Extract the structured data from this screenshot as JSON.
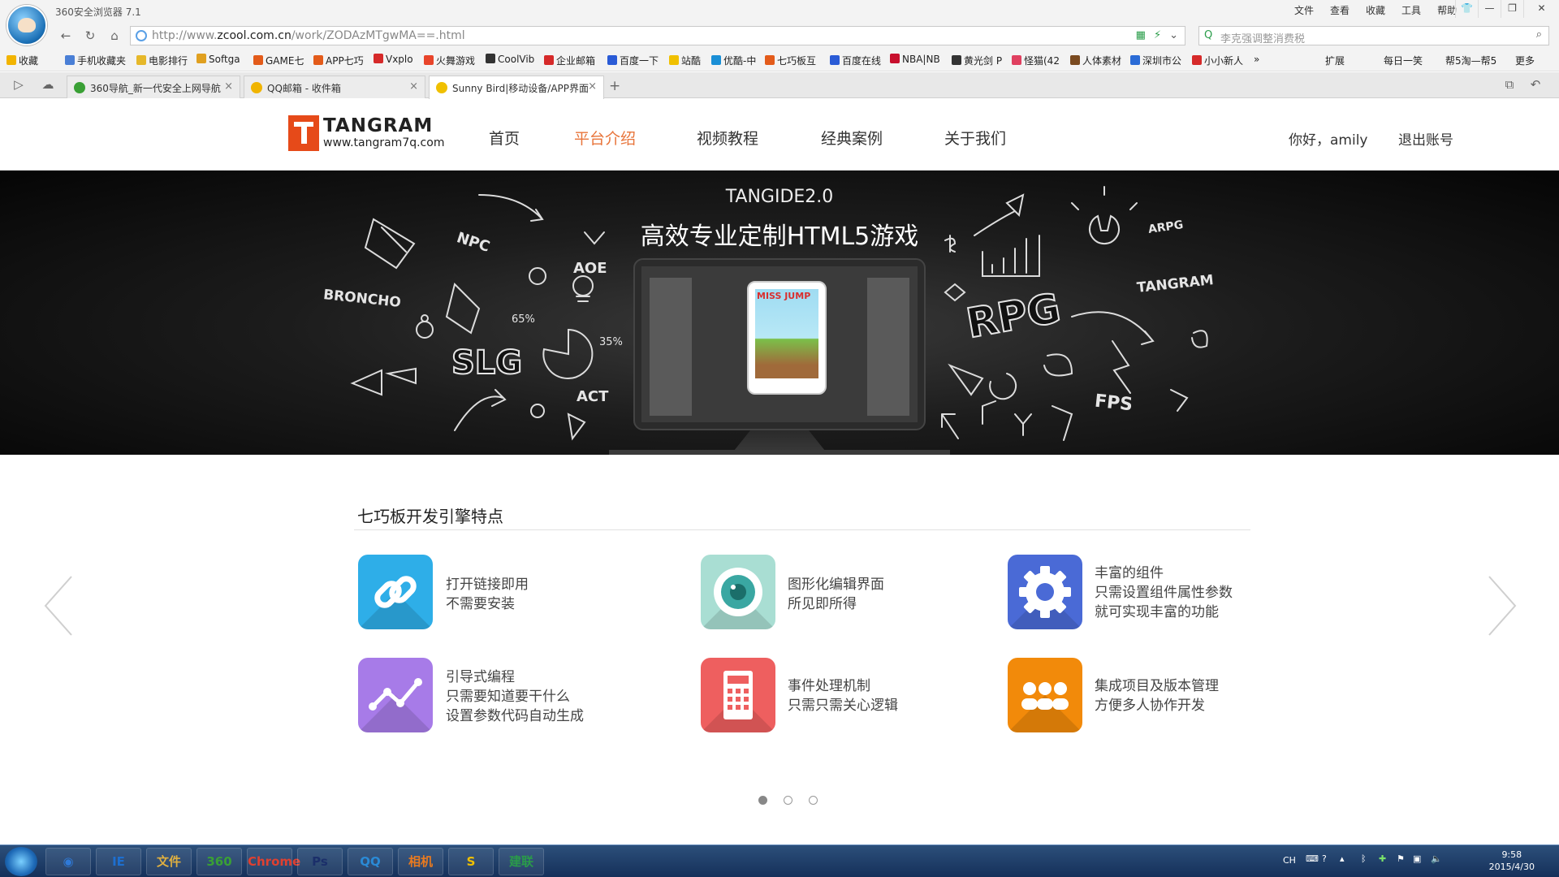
{
  "browser": {
    "title": "360安全浏览器 7.1",
    "menu": [
      "文件",
      "查看",
      "收藏",
      "工具",
      "帮助"
    ],
    "url_prefix": "http://www.",
    "url_domain": "zcool.com.cn",
    "url_path": "/work/ZODAzMTgwMA==.html",
    "search_placeholder": "李克强调整消费税",
    "favorites": [
      {
        "label": "收藏",
        "color": "#f2b400"
      },
      {
        "label": "手机收藏夹",
        "color": "#4a7fd6"
      },
      {
        "label": "电影排行",
        "color": "#e6b82a"
      },
      {
        "label": "Softga",
        "color": "#e0a020"
      },
      {
        "label": "GAME七",
        "color": "#e35b1a"
      },
      {
        "label": "APP七巧",
        "color": "#e35b1a"
      },
      {
        "label": "Vxplo",
        "color": "#d62a2a"
      },
      {
        "label": "火舞游戏",
        "color": "#e8442a"
      },
      {
        "label": "CoolVib",
        "color": "#333333"
      },
      {
        "label": "企业邮箱",
        "color": "#d62a2a"
      },
      {
        "label": "百度一下",
        "color": "#2a5bd6"
      },
      {
        "label": "站酷",
        "color": "#f0c000"
      },
      {
        "label": "优酷-中",
        "color": "#1a8fd6"
      },
      {
        "label": "七巧板互",
        "color": "#e35b1a"
      },
      {
        "label": "百度在线",
        "color": "#2a5bd6"
      },
      {
        "label": "NBA|NB",
        "color": "#c8102e"
      },
      {
        "label": "黄光剑 P",
        "color": "#333333"
      },
      {
        "label": "怪猫(42",
        "color": "#e04060"
      },
      {
        "label": "人体素材",
        "color": "#7a4a20"
      },
      {
        "label": "深圳市公",
        "color": "#2a6bd6"
      },
      {
        "label": "小小新人",
        "color": "#d62a2a"
      }
    ],
    "fav_right": [
      "扩展",
      "每日一笑",
      "帮5淘—帮5",
      "更多"
    ],
    "tabs": [
      {
        "label": "360导航_新一代安全上网导航",
        "color": "#3aa035"
      },
      {
        "label": "QQ邮箱 - 收件箱",
        "color": "#f0b400"
      },
      {
        "label": "Sunny Bird|移动设备/APP界面",
        "color": "#f0c000"
      }
    ]
  },
  "site": {
    "logo_name": "TANGRAM",
    "logo_url": "www.tangram7q.com",
    "nav": [
      "首页",
      "平台介绍",
      "视频教程",
      "经典案例",
      "关于我们"
    ],
    "active_nav": 1,
    "greeting": "你好，amily",
    "logout": "退出账号"
  },
  "banner": {
    "title": "TANGIDE2.0",
    "subtitle": "高效专业定制HTML5游戏",
    "game_title": "MISS JUMP",
    "doodles": [
      "NPC",
      "AOE",
      "BRONCHO",
      "65%",
      "35%",
      "SLG",
      "ACT",
      "ARPG",
      "TANGRAM",
      "RPG",
      "FPS"
    ]
  },
  "features": {
    "title": "七巧板开发引擎特点",
    "items": [
      {
        "icon": "link-icon",
        "color": "#2eaee8",
        "lines": [
          "打开链接即用",
          "不需要安装"
        ]
      },
      {
        "icon": "camera-lens-icon",
        "color": "#a9ded3",
        "lines": [
          "图形化编辑界面",
          "所见即所得"
        ]
      },
      {
        "icon": "gear-icon",
        "color": "#4a6ad6",
        "lines": [
          "丰富的组件",
          "只需设置组件属性参数",
          "就可实现丰富的功能"
        ]
      },
      {
        "icon": "chart-line-icon",
        "color": "#a77be8",
        "lines": [
          "引导式编程",
          "只需要知道要干什么",
          "设置参数代码自动生成"
        ]
      },
      {
        "icon": "calculator-icon",
        "color": "#ee5f5f",
        "lines": [
          "事件处理机制",
          "只需只需关心逻辑"
        ]
      },
      {
        "icon": "team-icon",
        "color": "#f28a0a",
        "lines": [
          "集成项目及版本管理",
          "方便多人协作开发"
        ]
      }
    ],
    "carousel_index": 0,
    "carousel_count": 3
  },
  "taskbar": {
    "apps": [
      "IE",
      "文件",
      "360",
      "Chrome",
      "Ps",
      "QQ",
      "相机",
      "S",
      "建联"
    ],
    "lang": "CH",
    "time": "9:58",
    "date": "2015/4/30"
  }
}
